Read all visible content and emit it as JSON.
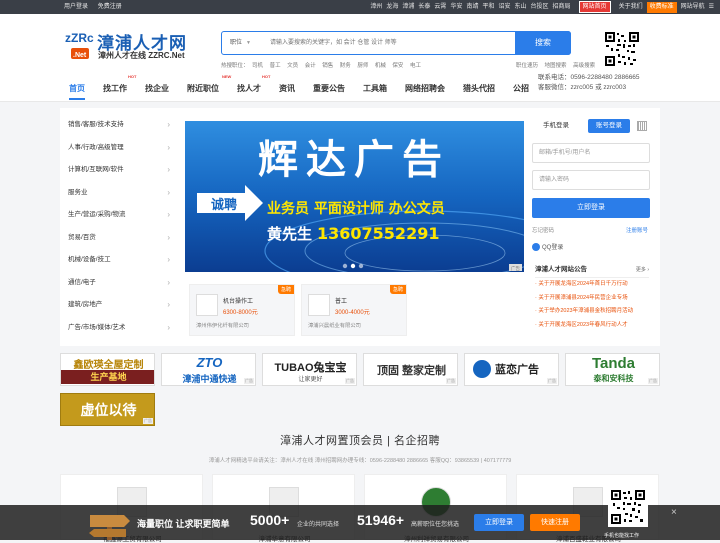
{
  "topbar": {
    "left": [
      "用户登录",
      "免费注册"
    ],
    "cities": [
      "漳州",
      "龙海",
      "漳浦",
      "长泰",
      "云霄",
      "华安",
      "南靖",
      "平和",
      "诏安",
      "东山",
      "台投区",
      "招商局"
    ],
    "homepage": "网站首页",
    "about": "关于我们",
    "fee": "收费标准",
    "sitenav": "网站导航",
    "menu_icon": "menu-icon"
  },
  "header": {
    "logo_text": "zZRc.Net",
    "site_name": "漳浦人才网",
    "site_sub": "漳州人才在线 ZZRC.Net",
    "search_type": "职位",
    "search_placeholder": "请输入要搜索的关键字，如 会计 仓管 设计 师等",
    "search_button": "搜索",
    "hot_label": "热搜职位：",
    "hot_terms": [
      "司机",
      "普工",
      "文员",
      "会计",
      "销售",
      "财务",
      "厨师",
      "机械",
      "保安",
      "电工"
    ],
    "hot_links": [
      "职位速历",
      "地图搜索",
      "高级搜索"
    ]
  },
  "nav": {
    "items": [
      "首页",
      "找工作",
      "找企业",
      "附近职位",
      "找人才",
      "资讯",
      "重要公告",
      "工具箱",
      "网络招聘会",
      "猎头代招",
      "公招"
    ],
    "tags": {
      "找工作": "HOT",
      "附近职位": "NEW",
      "找人才": "HOT"
    },
    "contact_phone": "联系电话：0596-2288480 2886665",
    "contact_qq": "客服微信：zzrc005 或 zzrc003"
  },
  "categories": [
    "销售/客服/技术支持",
    "人事/行政/高级管理",
    "计算机/互联网/软件",
    "服务业",
    "生产/营运/采购/物流",
    "贸易/百货",
    "机械/设备/技工",
    "通信/电子",
    "建筑/房地产",
    "广告/市场/媒体/艺术"
  ],
  "banner": {
    "title": "辉达广告",
    "recruit": "诚聘",
    "positions": "业务员  平面设计师  办公文员",
    "contact": "黄先生",
    "phone": "13607552291",
    "ad_tag": "广告"
  },
  "job_cards": [
    {
      "title": "机台操作工",
      "salary": "6300-8000元",
      "company": "漳州伟伊化纤有限公司",
      "badge": "急聘"
    },
    {
      "title": "普工",
      "salary": "3000-4000元",
      "company": "漳浦兴晨纸业有限公司",
      "badge": "急聘"
    }
  ],
  "login": {
    "tab_personal": "手机登录",
    "tab_account": "账号登录",
    "username_placeholder": "邮箱/手机号/用户名",
    "password_placeholder": "请输入密码",
    "login_button": "立即登录",
    "forgot": "忘记密码",
    "register": "注册账号",
    "qq": "QQ登录"
  },
  "notice": {
    "title": "漳浦人才网站公告",
    "more": "更多",
    "items": [
      "关于开展龙海区2024年首日千万行动",
      "关于开展漳浦县2024年民营企业专场",
      "关于举办2023年漳浦县金秋招聘月活动",
      "关于开展龙海区2023年春风行动人才"
    ]
  },
  "ads": [
    {
      "text": "鑫欧瑛全屋定制",
      "sub": "生产基地"
    },
    {
      "text": "漳浦中通快递",
      "sub": "ZTO"
    },
    {
      "text": "TUBAO兔宝宝",
      "sub": "让家更好"
    },
    {
      "text": "顶固 整家定制",
      "sub": ""
    },
    {
      "text": "蓝恋广告",
      "sub": ""
    },
    {
      "text": "Tanda",
      "sub": "泰和安科技"
    },
    {
      "text": "虚位以待",
      "sub": ""
    }
  ],
  "ad_tag": "广告",
  "section": {
    "title": "漳浦人才网置顶会员 | 名企招聘",
    "subtitle": "漳浦人才网精选平台请关注：漳州人才在线  漳州招聘网办理专线：0596-2288480 2886665 客服QQ：93865539 | 407177779"
  },
  "vip_companies": [
    "福鑫源工贸有限公司",
    "漳浦华意有限公司",
    "漳州利祥贸易有限公司",
    "漳浦百盛鞋业有限公司"
  ],
  "bottombar": {
    "slogan": "海量职位 让求职更简单",
    "count1": "5000+",
    "desc1": "企业的共同选择",
    "count2": "51946+",
    "desc2": "高薪职位任您挑选",
    "login": "立即登录",
    "register": "快速注册",
    "qr_label": "手机也能找工作",
    "close": "×"
  }
}
